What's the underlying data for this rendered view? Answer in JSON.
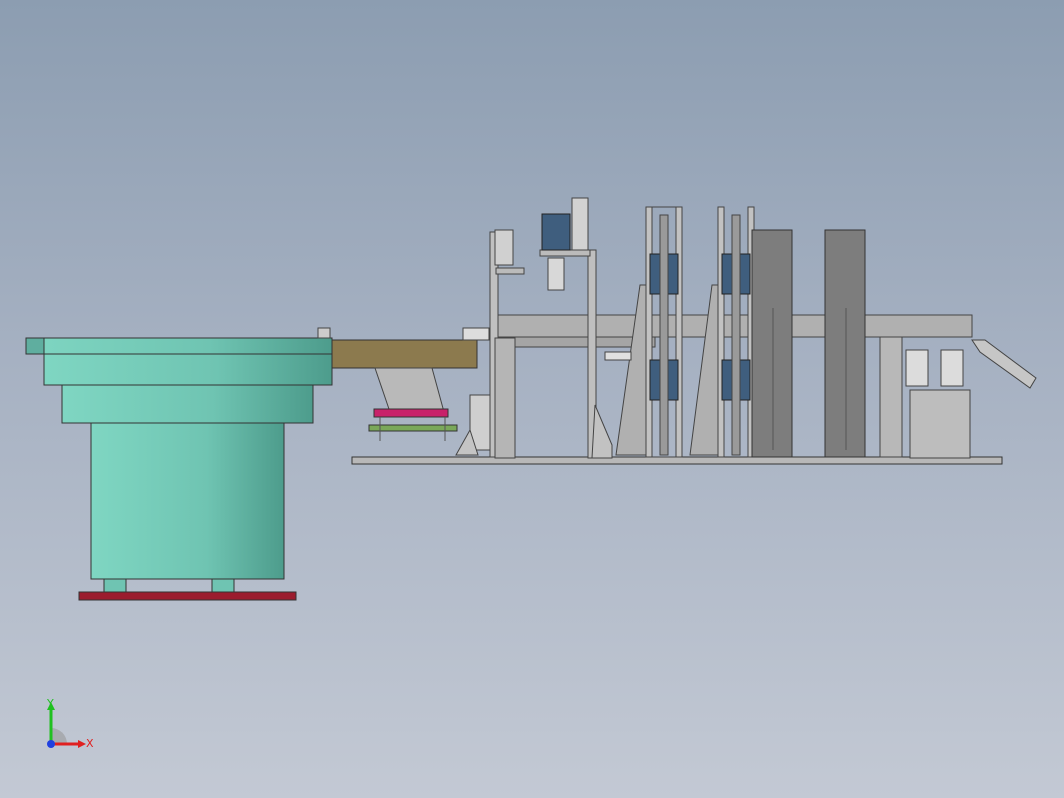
{
  "viewport": {
    "background_top": "#8c9db1",
    "background_bottom": "#c3c9d4"
  },
  "triad": {
    "x_label": "X",
    "y_label": "Y",
    "x_color": "#e02020",
    "y_color": "#20c020",
    "z_color": "#2040e0"
  },
  "colors": {
    "bowl": "#6fc4b2",
    "bowl_dark": "#4d9c8c",
    "base_plate": "#9b1c2e",
    "track": "#8c7a4e",
    "frame": "#a9a9a9",
    "frame_dark": "#7d7d7d",
    "motor": "#3f5e7e",
    "magenta_plate": "#c8216a",
    "green_plate": "#7aa85a"
  }
}
